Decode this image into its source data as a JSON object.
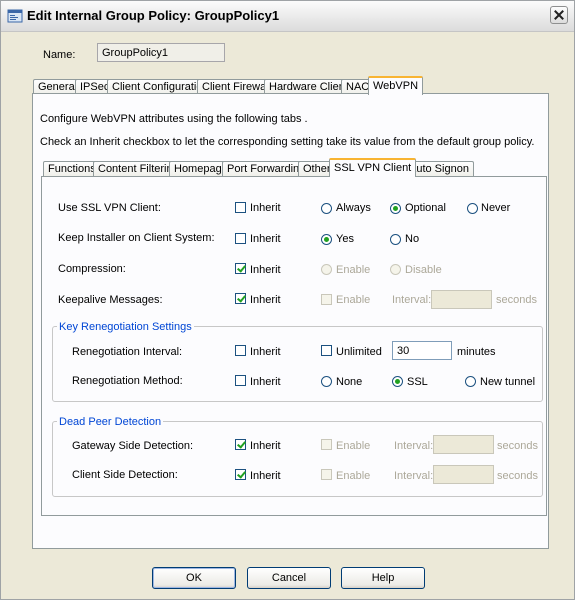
{
  "window": {
    "title": "Edit Internal Group Policy: GroupPolicy1",
    "icon": "policy-icon"
  },
  "name": {
    "label": "Name:",
    "value": "GroupPolicy1"
  },
  "tabs": [
    "General",
    "IPSec",
    "Client Configuration",
    "Client Firewall",
    "Hardware Client",
    "NAC",
    "WebVPN"
  ],
  "active_tab": "WebVPN",
  "desc1": "Configure WebVPN attributes using the following tabs .",
  "desc2": "Check an Inherit checkbox to let the corresponding setting take its value from the default group policy.",
  "subtabs": [
    "Functions",
    "Content Filtering",
    "Homepage",
    "Port Forwarding",
    "Other",
    "SSL VPN Client",
    "Auto Signon"
  ],
  "active_subtab": "SSL VPN Client",
  "inherit_label": "Inherit",
  "rows": {
    "use_ssl": {
      "label": "Use SSL VPN Client:",
      "inherit": false,
      "options": [
        "Always",
        "Optional",
        "Never"
      ],
      "selected": "Optional"
    },
    "keep_installer": {
      "label": "Keep Installer on Client System:",
      "inherit": false,
      "options": [
        "Yes",
        "No"
      ],
      "selected": "Yes"
    },
    "compression": {
      "label": "Compression:",
      "inherit": true,
      "options": [
        "Enable",
        "Disable"
      ]
    },
    "keepalive": {
      "label": "Keepalive Messages:",
      "inherit": true,
      "enable": "Enable",
      "interval_label": "Interval:",
      "unit": "seconds"
    }
  },
  "key_reneg": {
    "title": "Key Renegotiation Settings",
    "interval": {
      "label": "Renegotiation Interval:",
      "inherit": false,
      "unlimited": "Unlimited",
      "value": "30",
      "unit": "minutes"
    },
    "method": {
      "label": "Renegotiation Method:",
      "inherit": false,
      "options": [
        "None",
        "SSL",
        "New tunnel"
      ],
      "selected": "SSL"
    }
  },
  "dpd": {
    "title": "Dead Peer Detection",
    "gateway": {
      "label": "Gateway Side Detection:",
      "inherit": true,
      "enable": "Enable",
      "interval_label": "Interval:",
      "unit": "seconds"
    },
    "client": {
      "label": "Client Side Detection:",
      "inherit": true,
      "enable": "Enable",
      "interval_label": "Interval:",
      "unit": "seconds"
    }
  },
  "buttons": {
    "ok": "OK",
    "cancel": "Cancel",
    "help": "Help"
  }
}
